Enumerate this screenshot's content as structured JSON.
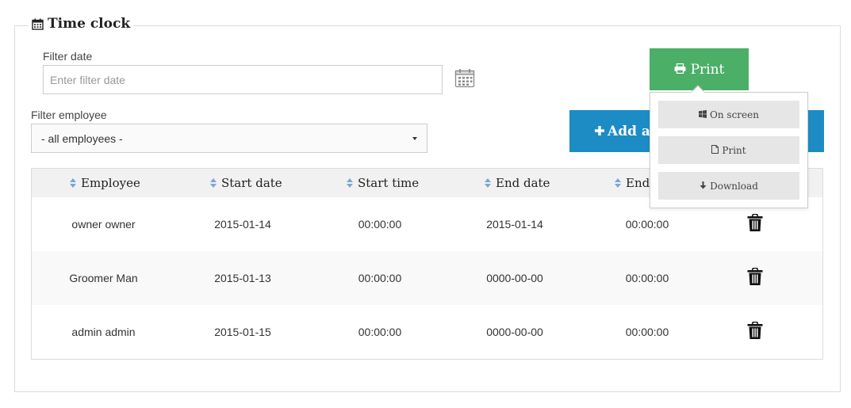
{
  "panel": {
    "title": "Time clock",
    "title_icon": "calendar-icon"
  },
  "filters": {
    "date_label": "Filter date",
    "date_placeholder": "Enter filter date",
    "date_value": "",
    "employee_label": "Filter employee",
    "employee_selected": "- all employees -"
  },
  "buttons": {
    "print_label": "Print",
    "add_label": "Add a"
  },
  "print_menu": {
    "items": [
      {
        "label": "On screen",
        "icon": "windows-icon"
      },
      {
        "label": "Print",
        "icon": "file-icon"
      },
      {
        "label": "Download",
        "icon": "arrow-down-icon"
      }
    ]
  },
  "table": {
    "headers": [
      "Employee",
      "Start date",
      "Start time",
      "End date",
      "End"
    ],
    "rows": [
      {
        "employee": "owner owner",
        "start_date": "2015-01-14",
        "start_time": "00:00:00",
        "end_date": "2015-01-14",
        "end_time": "00:00:00"
      },
      {
        "employee": "Groomer Man",
        "start_date": "2015-01-13",
        "start_time": "00:00:00",
        "end_date": "0000-00-00",
        "end_time": "00:00:00"
      },
      {
        "employee": "admin admin",
        "start_date": "2015-01-15",
        "start_time": "00:00:00",
        "end_date": "0000-00-00",
        "end_time": "00:00:00"
      }
    ]
  },
  "colors": {
    "print_button": "#4caf68",
    "add_button": "#1d8cc4",
    "sort_icon": "#7aa6d8"
  }
}
